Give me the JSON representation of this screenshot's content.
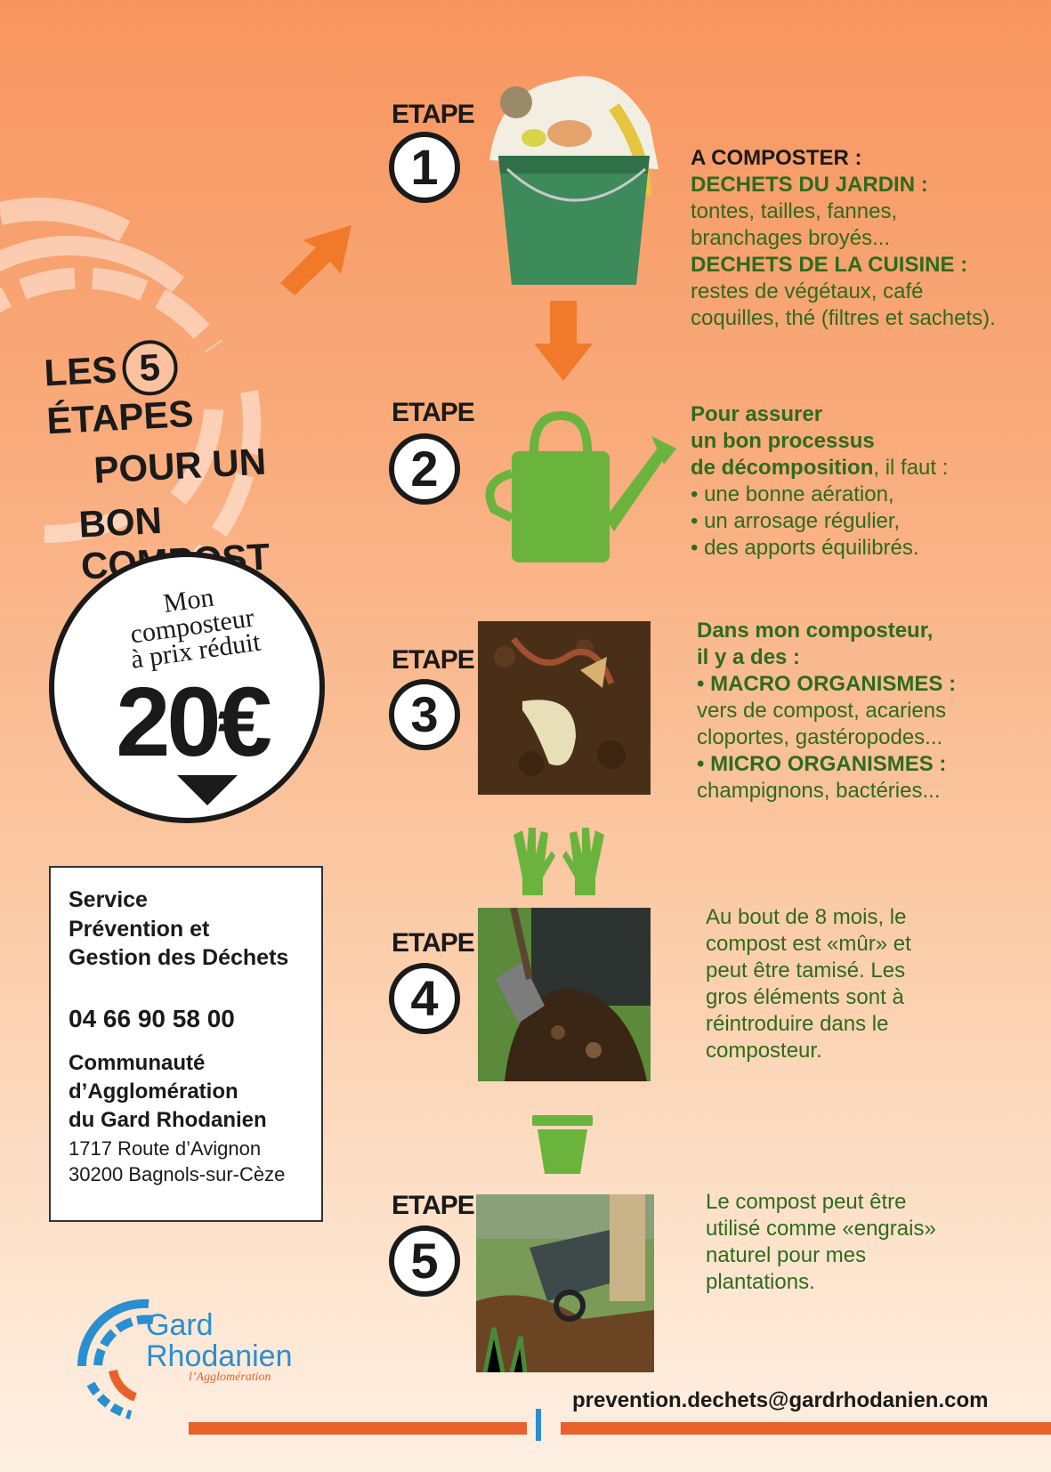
{
  "title": {
    "line1_a": "LES",
    "line1_num": "5",
    "line1_b": "ÉTAPES",
    "line2": "POUR UN",
    "line3": "BON COMPOST"
  },
  "price": {
    "line1": "Mon",
    "line2": "composteur",
    "line3": "à prix réduit",
    "amount": "20€"
  },
  "contact": {
    "service": [
      "Service",
      "Prévention et",
      "Gestion des Déchets"
    ],
    "phone": "04 66 90 58 00",
    "org": [
      "Communauté",
      "d’Agglomération",
      "du Gard Rhodanien"
    ],
    "address": [
      "1717 Route d’Avignon",
      "30200 Bagnols-sur-Cèze"
    ],
    "email": "prevention.dechets@gardrhodanien.com"
  },
  "logo": {
    "line1": "Gard",
    "line2": "Rhodanien",
    "tagline": "l’Agglomération"
  },
  "steps": [
    {
      "label": "ETAPE",
      "num": "1",
      "lines": [
        "A COMPOSTER :",
        "DECHETS DU JARDIN :",
        "tontes, tailles, fannes,",
        "branchages broyés...",
        "DECHETS DE LA CUISINE :",
        "restes de végétaux, café",
        "coquilles, thé (filtres et sachets)."
      ]
    },
    {
      "label": "ETAPE",
      "num": "2",
      "lines": [
        "Pour assurer",
        "un bon processus",
        "de décomposition",
        ", il faut :",
        "• une bonne aération,",
        "• un arrosage régulier,",
        "• des apports équilibrés."
      ]
    },
    {
      "label": "ETAPE",
      "num": "3",
      "lines": [
        "Dans mon composteur,",
        "il y a des :",
        "• MACRO ORGANISMES :",
        "vers de compost, acariens",
        "cloportes, gastéropodes...",
        "• MICRO ORGANISMES :",
        "champignons, bactéries..."
      ]
    },
    {
      "label": "ETAPE",
      "num": "4",
      "lines": [
        "Au bout de 8 mois, le",
        "compost est «mûr» et",
        "peut être tamisé. Les",
        "gros éléments sont à",
        "réintroduire dans le",
        "composteur."
      ]
    },
    {
      "label": "ETAPE",
      "num": "5",
      "lines": [
        "Le compost peut être",
        "utilisé comme «engrais»",
        "naturel pour mes",
        "plantations."
      ]
    }
  ],
  "colors": {
    "green": "#2e6b1e",
    "lightgreen": "#6ab43e",
    "orange": "#f07a2a",
    "dark": "#1a1a1a",
    "blue": "#2a8fd0"
  }
}
